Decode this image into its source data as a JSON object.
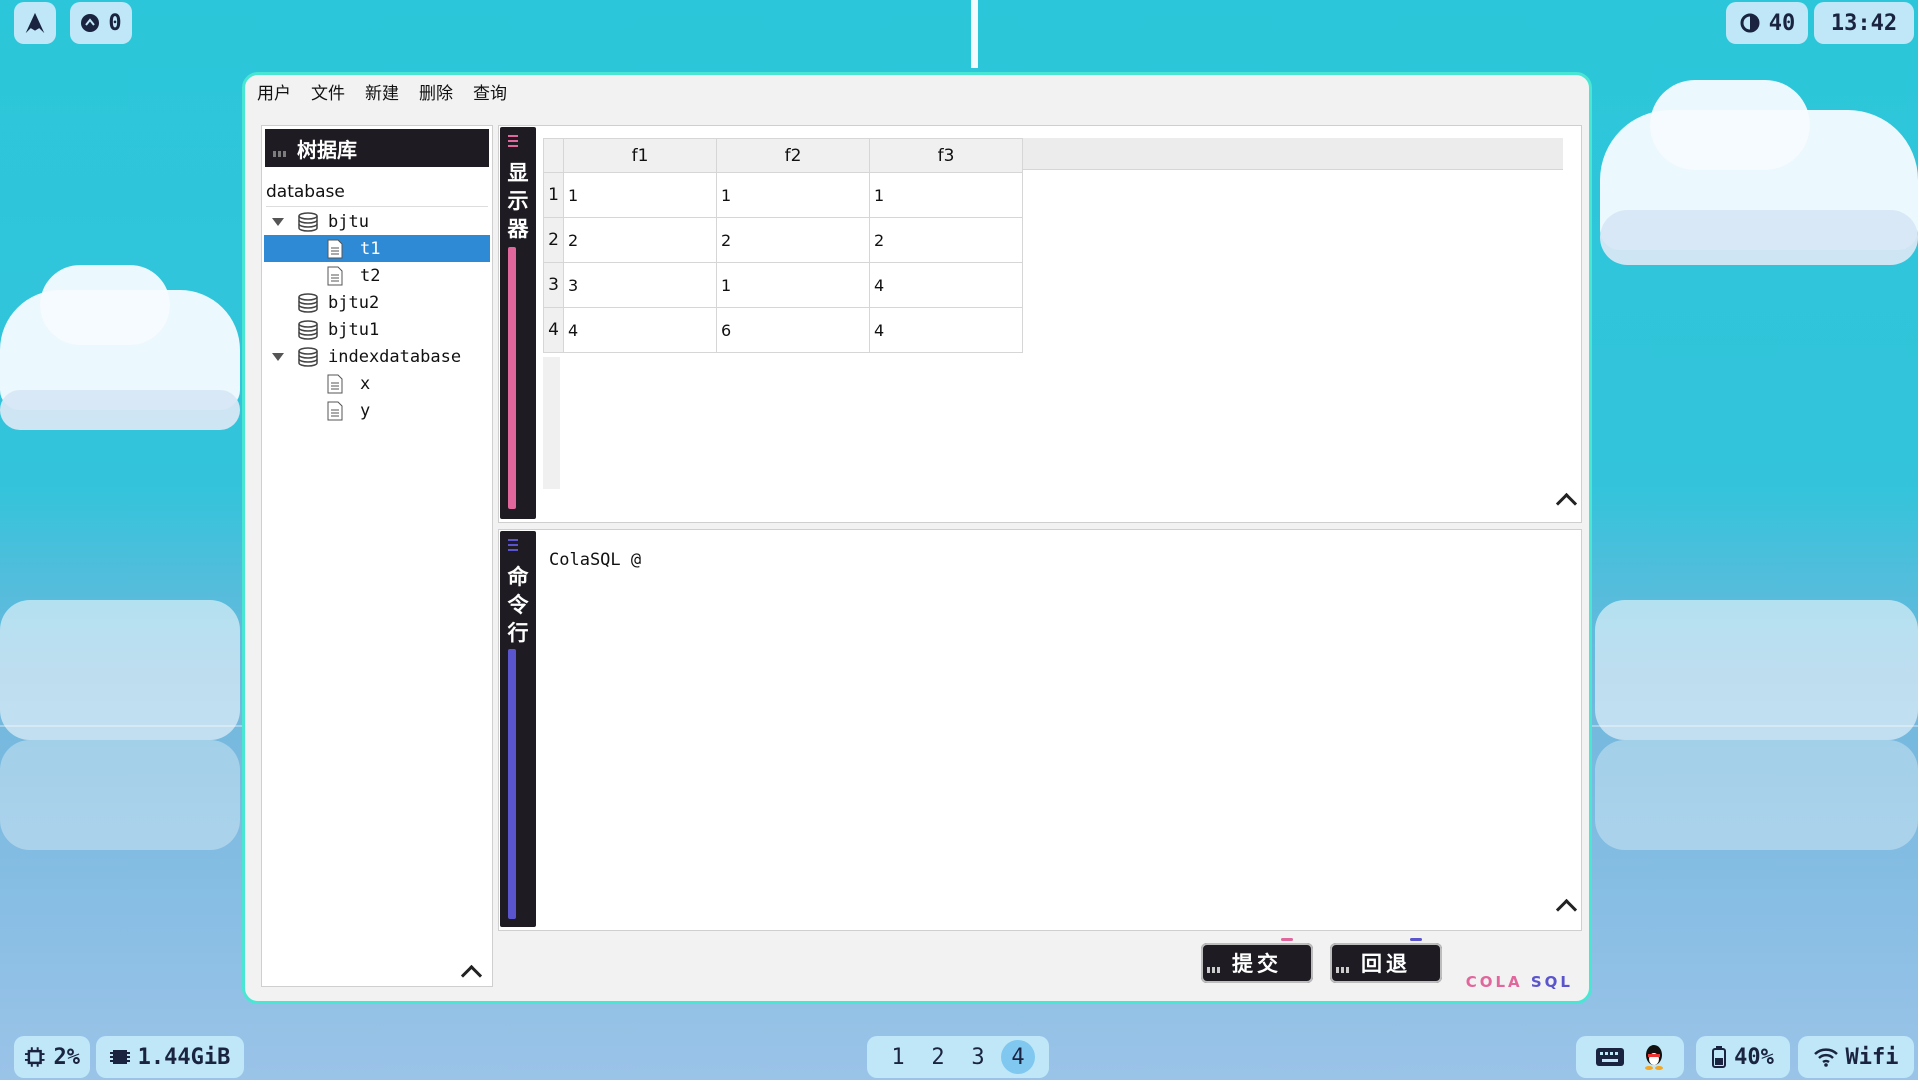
{
  "topbar": {
    "notifications_count": "0",
    "brightness": "40",
    "clock": "13:42"
  },
  "menu": [
    "用户",
    "文件",
    "新建",
    "删除",
    "查询"
  ],
  "tree_panel": {
    "title": "树据库",
    "header": "database",
    "items": [
      {
        "label": "bjtu"
      },
      {
        "label": "t1"
      },
      {
        "label": "t2"
      },
      {
        "label": "bjtu2"
      },
      {
        "label": "bjtu1"
      },
      {
        "label": "indexdatabase"
      },
      {
        "label": "x"
      },
      {
        "label": "y"
      }
    ]
  },
  "display_panel": {
    "tab_label": "显示器",
    "columns": [
      "f1",
      "f2",
      "f3"
    ],
    "rows": [
      {
        "n": "1",
        "cells": [
          "1",
          "1",
          "1"
        ]
      },
      {
        "n": "2",
        "cells": [
          "2",
          "2",
          "2"
        ]
      },
      {
        "n": "3",
        "cells": [
          "3",
          "1",
          "4"
        ]
      },
      {
        "n": "4",
        "cells": [
          "4",
          "6",
          "4"
        ]
      }
    ]
  },
  "command_panel": {
    "tab_label": "命令行",
    "prompt": "ColaSQL @"
  },
  "buttons": {
    "submit": "提交",
    "rollback": "回退"
  },
  "logo": {
    "part1": "COLA",
    "part2": "SQL"
  },
  "bottombar": {
    "cpu": "2%",
    "memory": "1.44GiB",
    "workspaces": [
      "1",
      "2",
      "3",
      "4"
    ],
    "active_workspace": "4",
    "battery": "40%",
    "network": "Wifi"
  },
  "colors": {
    "window_border": "#49e7d3",
    "display_accent": "#e0669b",
    "command_accent": "#5a55cc",
    "selection": "#2f8ad6"
  }
}
